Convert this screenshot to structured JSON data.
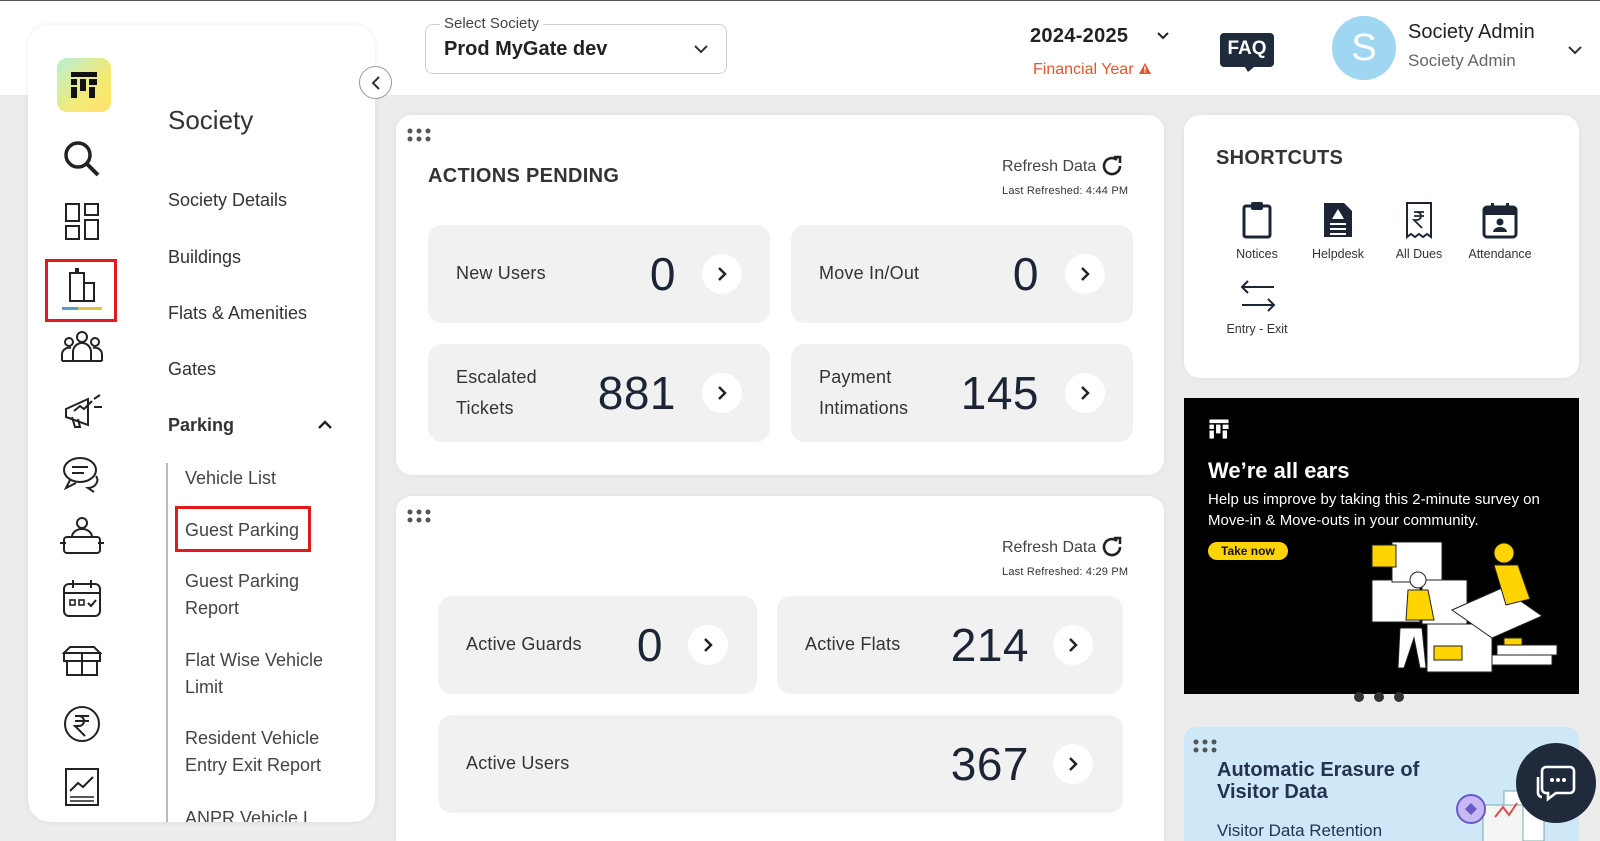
{
  "header": {
    "society_select": {
      "label": "Select Society",
      "value": "Prod MyGate dev"
    },
    "financial_year": {
      "year": "2024-2025",
      "label": "Financial Year"
    },
    "faq_label": "FAQ",
    "user": {
      "initial": "S",
      "name": "Society Admin",
      "role": "Society Admin"
    }
  },
  "sidebar": {
    "icons": [
      "search-icon",
      "dashboard-icon",
      "building-icon",
      "residents-icon",
      "announcement-icon",
      "chat-icon",
      "service-icon",
      "calendar-icon",
      "amenities-icon",
      "rupee-icon",
      "reports-icon"
    ],
    "section_title": "Society",
    "items": [
      "Society Details",
      "Buildings",
      "Flats & Amenities",
      "Gates"
    ],
    "parking": {
      "label": "Parking",
      "subitems": [
        "Vehicle List",
        "Guest Parking",
        "Guest Parking Report",
        "Flat Wise Vehicle Limit",
        "Resident Vehicle Entry Exit Report",
        "ANPR Vehicle L"
      ]
    }
  },
  "actions_pending": {
    "title": "ACTIONS PENDING",
    "refresh_label": "Refresh Data",
    "last_refreshed": "Last Refreshed: 4:44 PM",
    "stats": [
      {
        "label": "New Users",
        "value": "0"
      },
      {
        "label": "Move In/Out",
        "value": "0"
      },
      {
        "label": "Escalated Tickets",
        "value": "881"
      },
      {
        "label": "Payment Intimations",
        "value": "145"
      }
    ]
  },
  "overview": {
    "refresh_label": "Refresh Data",
    "last_refreshed": "Last Refreshed: 4:29 PM",
    "stats": [
      {
        "label": "Active Guards",
        "value": "0"
      },
      {
        "label": "Active Flats",
        "value": "214"
      },
      {
        "label": "Active Users",
        "value": "367"
      }
    ]
  },
  "shortcuts": {
    "title": "SHORTCUTS",
    "items": [
      {
        "label": "Notices",
        "icon": "clipboard-icon"
      },
      {
        "label": "Helpdesk",
        "icon": "helpdesk-icon"
      },
      {
        "label": "All Dues",
        "icon": "dues-icon"
      },
      {
        "label": "Attendance",
        "icon": "attendance-icon"
      },
      {
        "label": "Entry - Exit",
        "icon": "entry-exit-icon"
      }
    ]
  },
  "banner": {
    "title": "We’re all ears",
    "subtitle": "Help us improve by taking this 2-minute survey on Move-in & Move-outs in your community.",
    "button": "Take now"
  },
  "erasure": {
    "title": "Automatic Erasure of Visitor Data",
    "subtitle": "Visitor Data Retention"
  },
  "colors": {
    "accent_red": "#e11b1b",
    "warning_orange": "#e2572e",
    "avatar_blue": "#9fd6f2",
    "banner_yellow": "#ffd400",
    "dark_navy": "#1f2a3a"
  }
}
